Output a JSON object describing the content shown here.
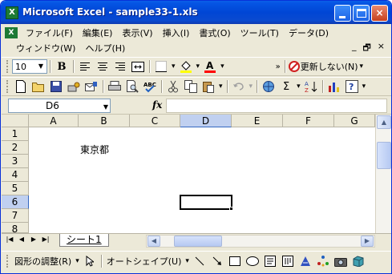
{
  "window": {
    "title": "Microsoft Excel - sample33-1.xls",
    "app_icon_glyph": "X",
    "minimize_label": "_",
    "maximize_label": "□",
    "close_label": "×"
  },
  "menu": {
    "row1": [
      "ファイル(F)",
      "編集(E)",
      "表示(V)",
      "挿入(I)",
      "書式(O)",
      "ツール(T)",
      "データ(D)"
    ],
    "row2": [
      "ウィンドウ(W)",
      "ヘルプ(H)"
    ],
    "mdi_min": "_",
    "mdi_restore": "🗗",
    "mdi_close": "×"
  },
  "format_toolbar": {
    "font_size": "10",
    "bold": "B",
    "refresh_label": "更新しない(N)"
  },
  "formula_bar": {
    "name_box": "D6",
    "fx_label": "fx",
    "formula_value": ""
  },
  "sheet": {
    "columns": [
      "A",
      "B",
      "C",
      "D",
      "E",
      "F",
      "G"
    ],
    "rows": [
      "1",
      "2",
      "3",
      "4",
      "5",
      "6",
      "7",
      "8"
    ],
    "active_column": "D",
    "active_row": "6",
    "cell_B2": "東京都"
  },
  "tabs": {
    "sheet1": "シート1"
  },
  "drawing_toolbar": {
    "draw_label": "図形の調整(R)",
    "autoshape_label": "オートシェイプ(U)"
  },
  "colors": {
    "titlebar": "#0046d5",
    "chrome": "#ece9d8",
    "selected_header": "#c0d0f0",
    "highlight_yellow": "#ffff00",
    "font_red": "#ff0000"
  }
}
